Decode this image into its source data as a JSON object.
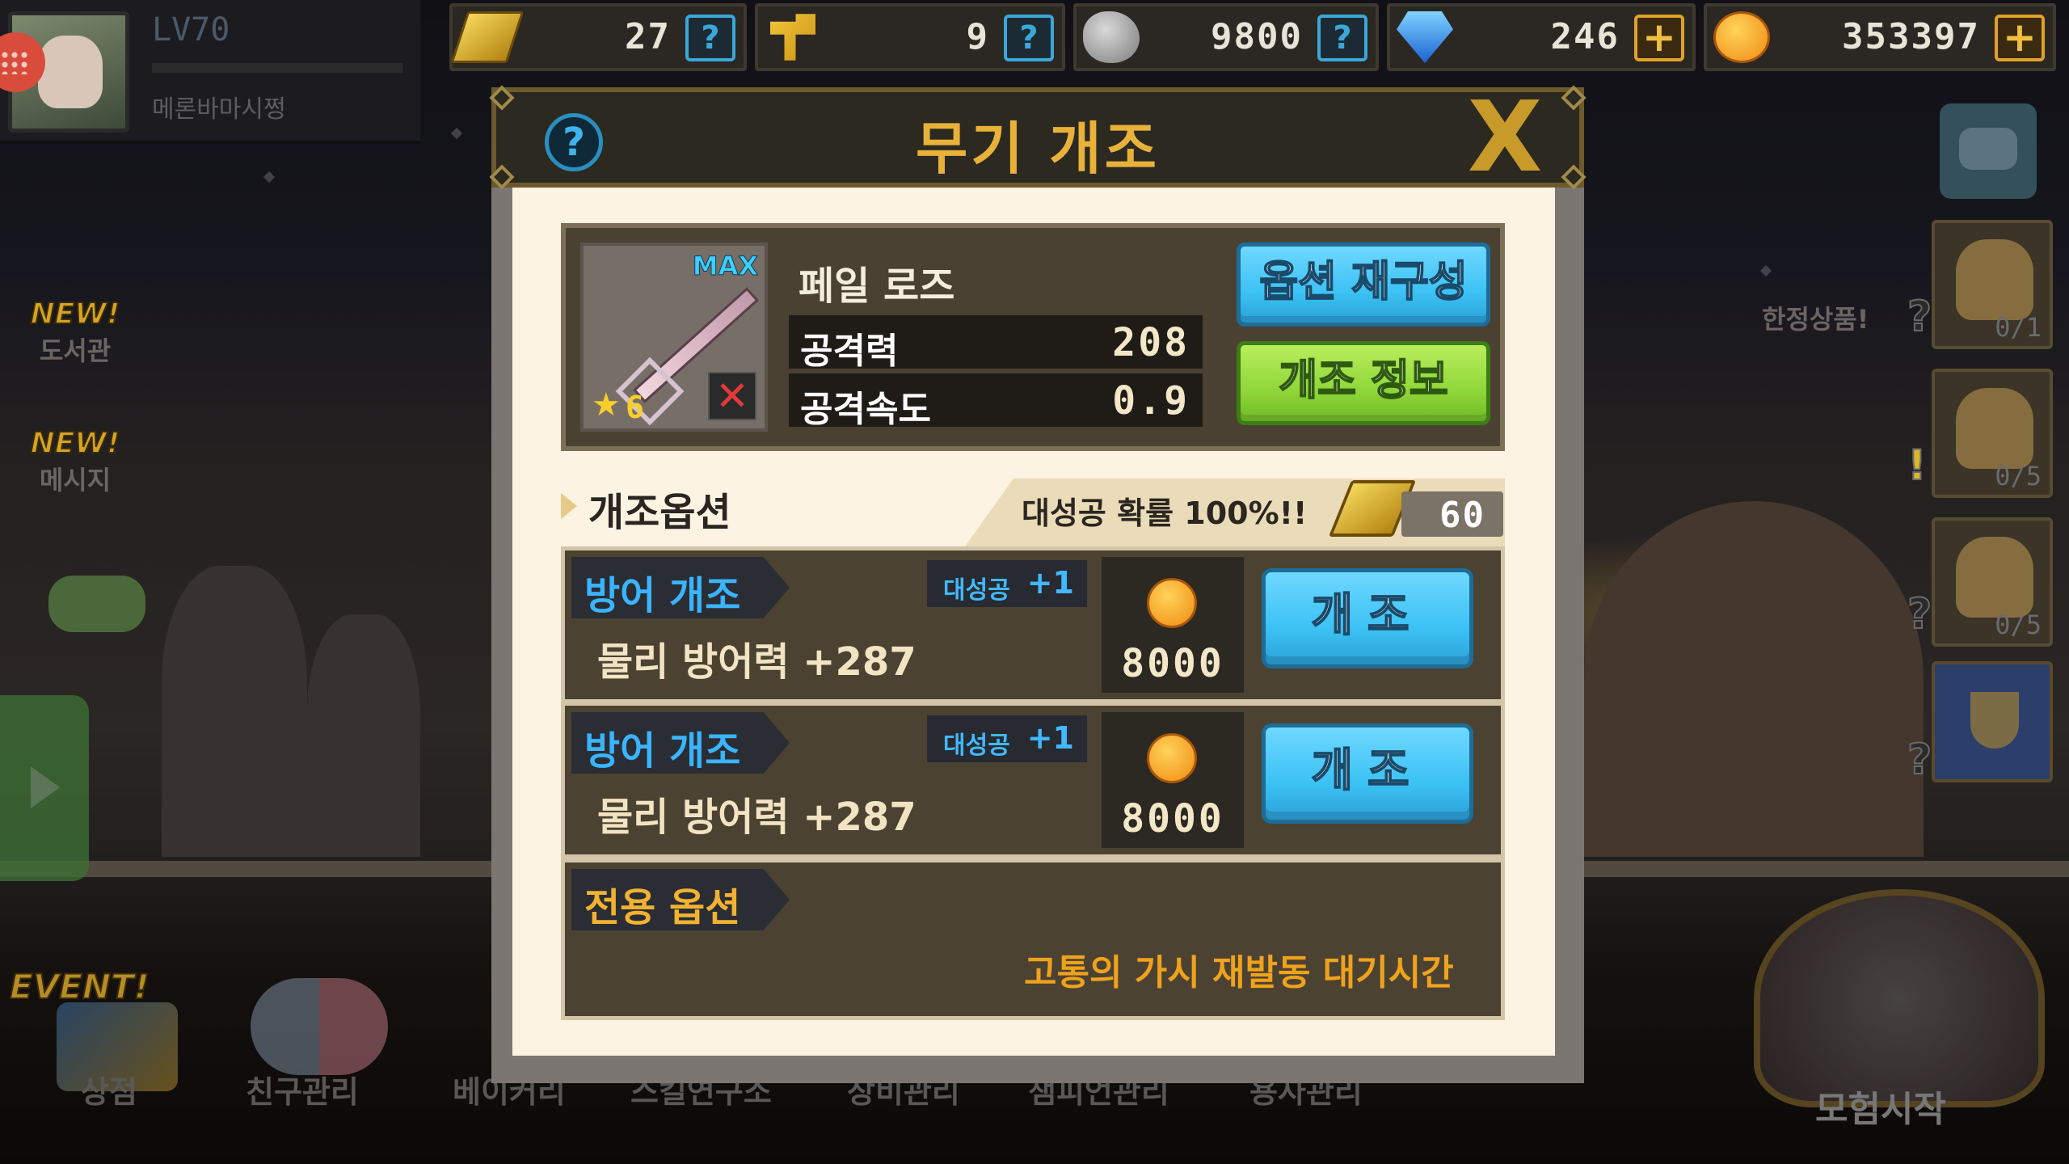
{
  "player": {
    "level": "LV70",
    "name": "메론바마시쩡"
  },
  "resources": [
    {
      "icon": "ticket-icon",
      "value": "27",
      "action": "help"
    },
    {
      "icon": "hammer-icon",
      "value": "9",
      "action": "help"
    },
    {
      "icon": "stone-icon",
      "value": "9800",
      "action": "help"
    },
    {
      "icon": "gem-icon",
      "value": "246",
      "action": "add"
    },
    {
      "icon": "coin-icon",
      "value": "353397",
      "action": "add"
    }
  ],
  "left_menu": {
    "new_tag": "NEW!",
    "library_label": "도서관",
    "message_label": "메시지"
  },
  "right_menu": {
    "limited_label": "한정상품!",
    "hero_slots": [
      "0/1",
      "0/5",
      "0/5"
    ]
  },
  "bottom_menu": {
    "event_tag": "EVENT!",
    "items": [
      "상점",
      "친구관리",
      "베이커리",
      "스킬연구소",
      "장비관리",
      "챔피언관리",
      "용사관리"
    ],
    "adventure_label": "모험시작"
  },
  "modal": {
    "help_glyph": "?",
    "title": "무기 개조",
    "close_glyph": "X",
    "item": {
      "max_label": "MAX",
      "stars": "6",
      "name": "페일 로즈",
      "stats": [
        {
          "label": "공격력",
          "value": "208"
        },
        {
          "label": "공격속도",
          "value": "0.9"
        }
      ],
      "reroll_label": "옵션 재구성",
      "info_label": "개조 정보"
    },
    "options_title": "개조옵션",
    "great_success_text": "대성공 확률 100%!!",
    "ticket_cost": "60",
    "options": [
      {
        "name": "방어 개조",
        "bonus_label": "대성공",
        "bonus_value": "+1",
        "desc": "물리 방어력 +287",
        "price": "8000",
        "button": "개조"
      },
      {
        "name": "방어 개조",
        "bonus_label": "대성공",
        "bonus_value": "+1",
        "desc": "물리 방어력 +287",
        "price": "8000",
        "button": "개조"
      }
    ],
    "exclusive_title": "전용 옵션",
    "exclusive_desc": "고통의 가시 재발동 대기시간"
  }
}
